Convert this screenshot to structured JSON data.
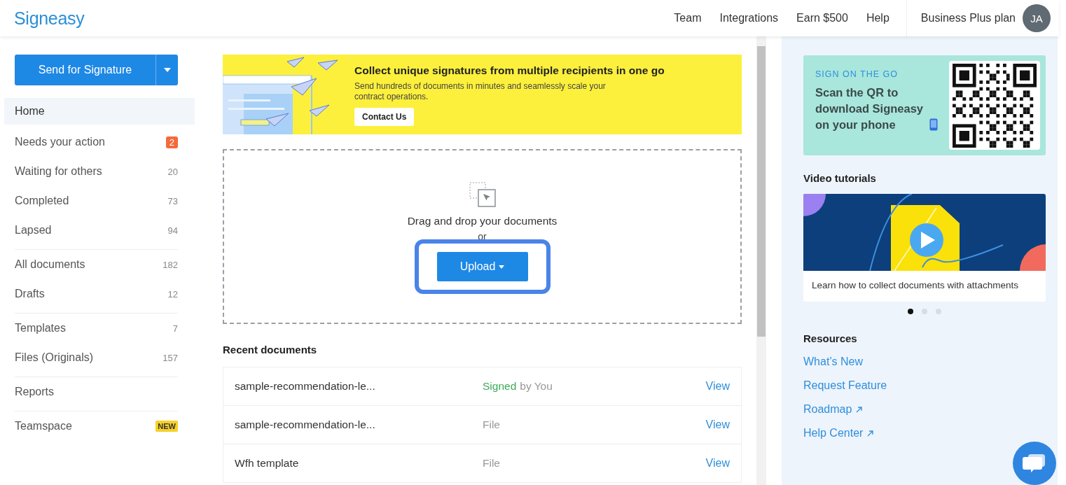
{
  "header": {
    "logo": "Signeasy",
    "nav": [
      "Team",
      "Integrations",
      "Earn $500",
      "Help"
    ],
    "plan": "Business Plus plan",
    "avatar": "JA"
  },
  "sidebar": {
    "primary_button": "Send for Signature",
    "items": [
      {
        "label": "Home",
        "selected": true,
        "separator_above": false
      },
      {
        "label": "Needs your action",
        "selected": false,
        "separator_above": false,
        "badge": {
          "text": "2",
          "kind": "alert"
        }
      },
      {
        "label": "Waiting for others",
        "selected": false,
        "separator_above": false,
        "badge": {
          "text": "20",
          "kind": "count"
        }
      },
      {
        "label": "Completed",
        "selected": false,
        "separator_above": false,
        "badge": {
          "text": "73",
          "kind": "count"
        }
      },
      {
        "label": "Lapsed",
        "selected": false,
        "separator_above": false,
        "badge": {
          "text": "94",
          "kind": "count"
        }
      },
      {
        "label": "All documents",
        "selected": false,
        "separator_above": true,
        "badge": {
          "text": "182",
          "kind": "count"
        }
      },
      {
        "label": "Drafts",
        "selected": false,
        "separator_above": false,
        "badge": {
          "text": "12",
          "kind": "count"
        }
      },
      {
        "label": "Templates",
        "selected": false,
        "separator_above": true,
        "badge": {
          "text": "7",
          "kind": "count"
        }
      },
      {
        "label": "Files (Originals)",
        "selected": false,
        "separator_above": false,
        "badge": {
          "text": "157",
          "kind": "count"
        }
      },
      {
        "label": "Reports",
        "selected": false,
        "separator_above": true
      },
      {
        "label": "Teamspace",
        "selected": false,
        "separator_above": true,
        "badge": {
          "text": "NEW",
          "kind": "new"
        }
      }
    ]
  },
  "banner": {
    "title": "Collect unique signatures from multiple recipients in one go",
    "text": "Send hundreds of documents in minutes and seamlessly scale your contract operations.",
    "button": "Contact Us"
  },
  "dropzone": {
    "text": "Drag and drop your documents",
    "or": "or",
    "button": "Upload",
    "highlighted": true
  },
  "recent": {
    "title": "Recent documents",
    "rows": [
      {
        "name": "sample-recommendation-le...",
        "status": {
          "kind": "signed",
          "label": "Signed",
          "detail": "by You"
        },
        "action": "View"
      },
      {
        "name": "sample-recommendation-le...",
        "status": {
          "kind": "file",
          "label": "File"
        },
        "action": "View"
      },
      {
        "name": "Wfh template",
        "status": {
          "kind": "file",
          "label": "File"
        },
        "action": "View"
      }
    ]
  },
  "promo": {
    "eyebrow": "SIGN ON THE GO",
    "text": "Scan the QR to download Signeasy on your phone"
  },
  "videos": {
    "title": "Video tutorials",
    "caption": "Learn how to collect documents with attachments",
    "dots": [
      {
        "selected": true
      },
      {
        "selected": false
      },
      {
        "selected": false
      }
    ]
  },
  "resources": {
    "title": "Resources",
    "links": [
      {
        "label": "What’s New",
        "external": false
      },
      {
        "label": "Request Feature",
        "external": false
      },
      {
        "label": "Roadmap",
        "external": true
      },
      {
        "label": "Help Center",
        "external": true
      }
    ]
  }
}
